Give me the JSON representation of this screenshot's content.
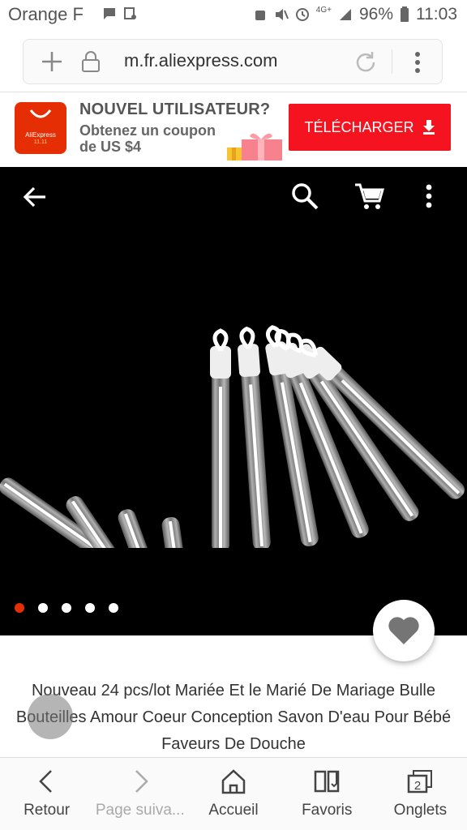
{
  "status_bar": {
    "carrier": "Orange F",
    "network": "4G+",
    "battery": "96%",
    "time": "11:03"
  },
  "browser": {
    "url": "m.fr.aliexpress.com"
  },
  "promo": {
    "logo_label": "AliExpress",
    "logo_sublabel": "11.11",
    "headline": "NOUVEL UTILISATEUR?",
    "line1": "Obtenez un coupon",
    "line2": "de US $4",
    "download_label": "TÉLÉCHARGER",
    "accent": "#f5131f"
  },
  "hero": {
    "image_count": 5,
    "active_index": 0,
    "icons": [
      "back-arrow-icon",
      "search-icon",
      "cart-icon",
      "more-vert-icon"
    ]
  },
  "product": {
    "title": "Nouveau 24 pcs/lot Mariée Et le Marié De Mariage Bulle Bouteilles Amour Coeur Conception Savon D'eau Pour Bébé Faveurs De Douche"
  },
  "bottom_nav": {
    "items": [
      {
        "label": "Retour",
        "icon": "chevron-left-icon"
      },
      {
        "label": "Page suiva...",
        "icon": "chevron-right-icon"
      },
      {
        "label": "Accueil",
        "icon": "home-icon"
      },
      {
        "label": "Favoris",
        "icon": "bookmark-book-icon"
      },
      {
        "label": "Onglets",
        "icon": "tabs-icon",
        "count": "2"
      }
    ]
  }
}
